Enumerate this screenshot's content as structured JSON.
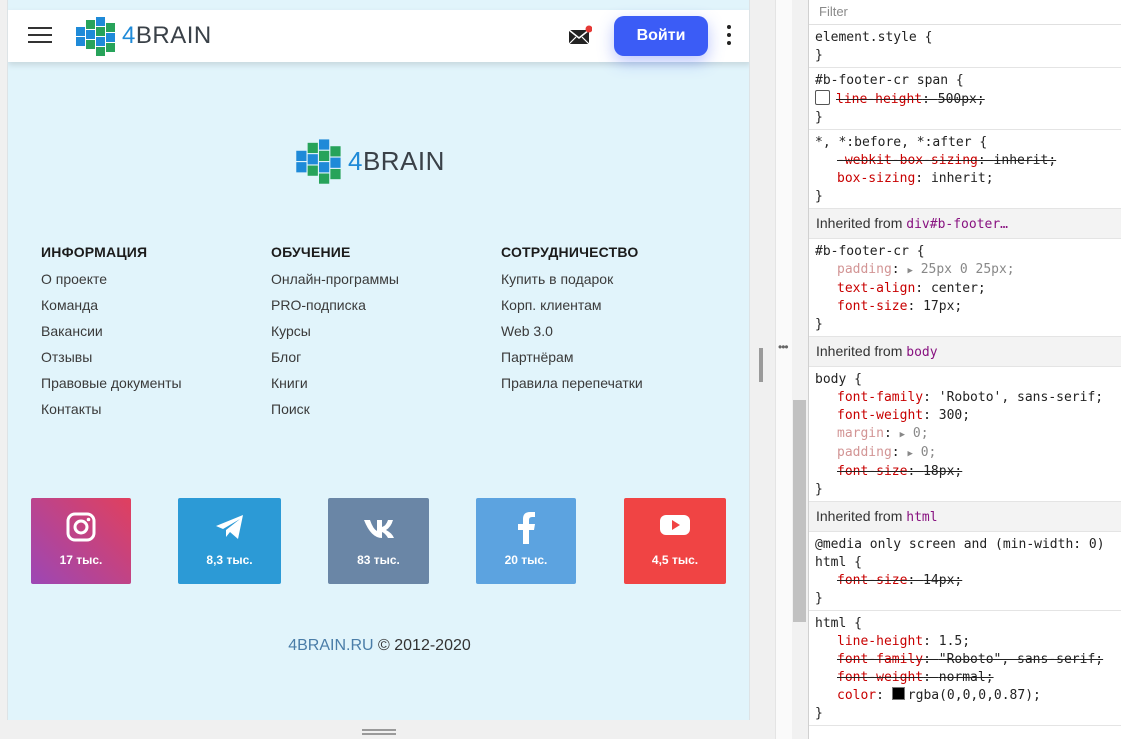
{
  "header": {
    "logo": {
      "four": "4",
      "brain": "BRAIN"
    },
    "login_label": "Войти"
  },
  "footer": {
    "logo": {
      "four": "4",
      "brain": "BRAIN"
    },
    "columns": [
      {
        "title": "ИНФОРМАЦИЯ",
        "links": [
          "О проекте",
          "Команда",
          "Вакансии",
          "Отзывы",
          "Правовые документы",
          "Контакты"
        ]
      },
      {
        "title": "ОБУЧЕНИЕ",
        "links": [
          "Онлайн-программы",
          "PRO-подписка",
          "Курсы",
          "Блог",
          "Книги",
          "Поиск"
        ]
      },
      {
        "title": "СОТРУДНИЧЕСТВО",
        "links": [
          "Купить в подарок",
          "Корп. клиентам",
          "Web 3.0",
          "Партнёрам",
          "Правила перепечатки"
        ]
      }
    ],
    "social": [
      {
        "icon": "instagram-icon",
        "count": "17 тыс.",
        "color": "#c13584"
      },
      {
        "icon": "telegram-icon",
        "count": "8,3 тыс.",
        "color": "#2c9ad6"
      },
      {
        "icon": "vk-icon",
        "count": "83 тыс.",
        "color": "#6a86a6"
      },
      {
        "icon": "facebook-icon",
        "count": "20 тыс.",
        "color": "#5ca3e0"
      },
      {
        "icon": "youtube-icon",
        "count": "4,5 тыс.",
        "color": "#f04444"
      }
    ],
    "copyright": {
      "site": "4BRAIN.RU",
      "text": " © 2012-2020"
    }
  },
  "devtools": {
    "filter_placeholder": "Filter",
    "rules": {
      "element_style": {
        "selector": "element.style {",
        "close": "}"
      },
      "footer_span": {
        "selector": "#b-footer-cr span {",
        "prop": "line-height",
        "value": "500px;",
        "close": "}"
      },
      "universal": {
        "selector": "*, *:before, *:after {",
        "p1": "-webkit-box-sizing",
        "v1": "inherit;",
        "p2": "box-sizing",
        "v2": "inherit;",
        "close": "}"
      },
      "inherited_1": {
        "label": "Inherited from ",
        "tag": "div#b-footer…"
      },
      "footer_cr": {
        "selector": "#b-footer-cr {",
        "p1": "padding",
        "v1": "25px 0 25px;",
        "p2": "text-align",
        "v2": "center;",
        "p3": "font-size",
        "v3": "17px;",
        "close": "}"
      },
      "inherited_2": {
        "label": "Inherited from ",
        "tag": "body"
      },
      "body": {
        "selector": "body {",
        "p1": "font-family",
        "v1": "'Roboto', sans-serif;",
        "p2": "font-weight",
        "v2": "300;",
        "p3": "margin",
        "v3": "0;",
        "p4": "padding",
        "v4": "0;",
        "p5": "font-size",
        "v5": "18px;",
        "close": "}"
      },
      "inherited_3": {
        "label": "Inherited from ",
        "tag": "html"
      },
      "media_html": {
        "media": "@media only screen and (min-width: 0)",
        "selector": "html {",
        "p1": "font-size",
        "v1": "14px;",
        "close": "}"
      },
      "html": {
        "selector": "html {",
        "p1": "line-height",
        "v1": "1.5;",
        "p2": "font-family",
        "v2": "\"Roboto\", sans-serif;",
        "p3": "font-weight",
        "v3": "normal;",
        "p4": "color",
        "v4": "rgba(0,0,0,0.87);",
        "close": "}"
      }
    }
  }
}
